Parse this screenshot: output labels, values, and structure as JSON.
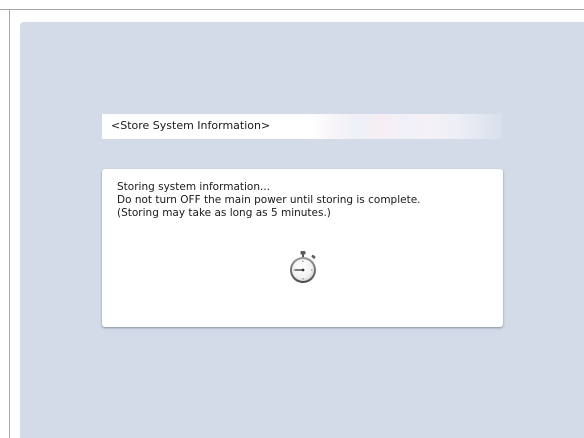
{
  "dialog": {
    "title": "<Store System Information>",
    "message_lines": [
      "Storing system information...",
      "Do not turn OFF the main power until storing is complete.",
      "(Storing may take as long as 5 minutes.)"
    ],
    "icon": "stopwatch-icon"
  },
  "colors": {
    "screen_background": "#d3dbe8",
    "panel_background": "#ffffff",
    "text": "#1a1a1a",
    "icon_stroke": "#333333"
  }
}
